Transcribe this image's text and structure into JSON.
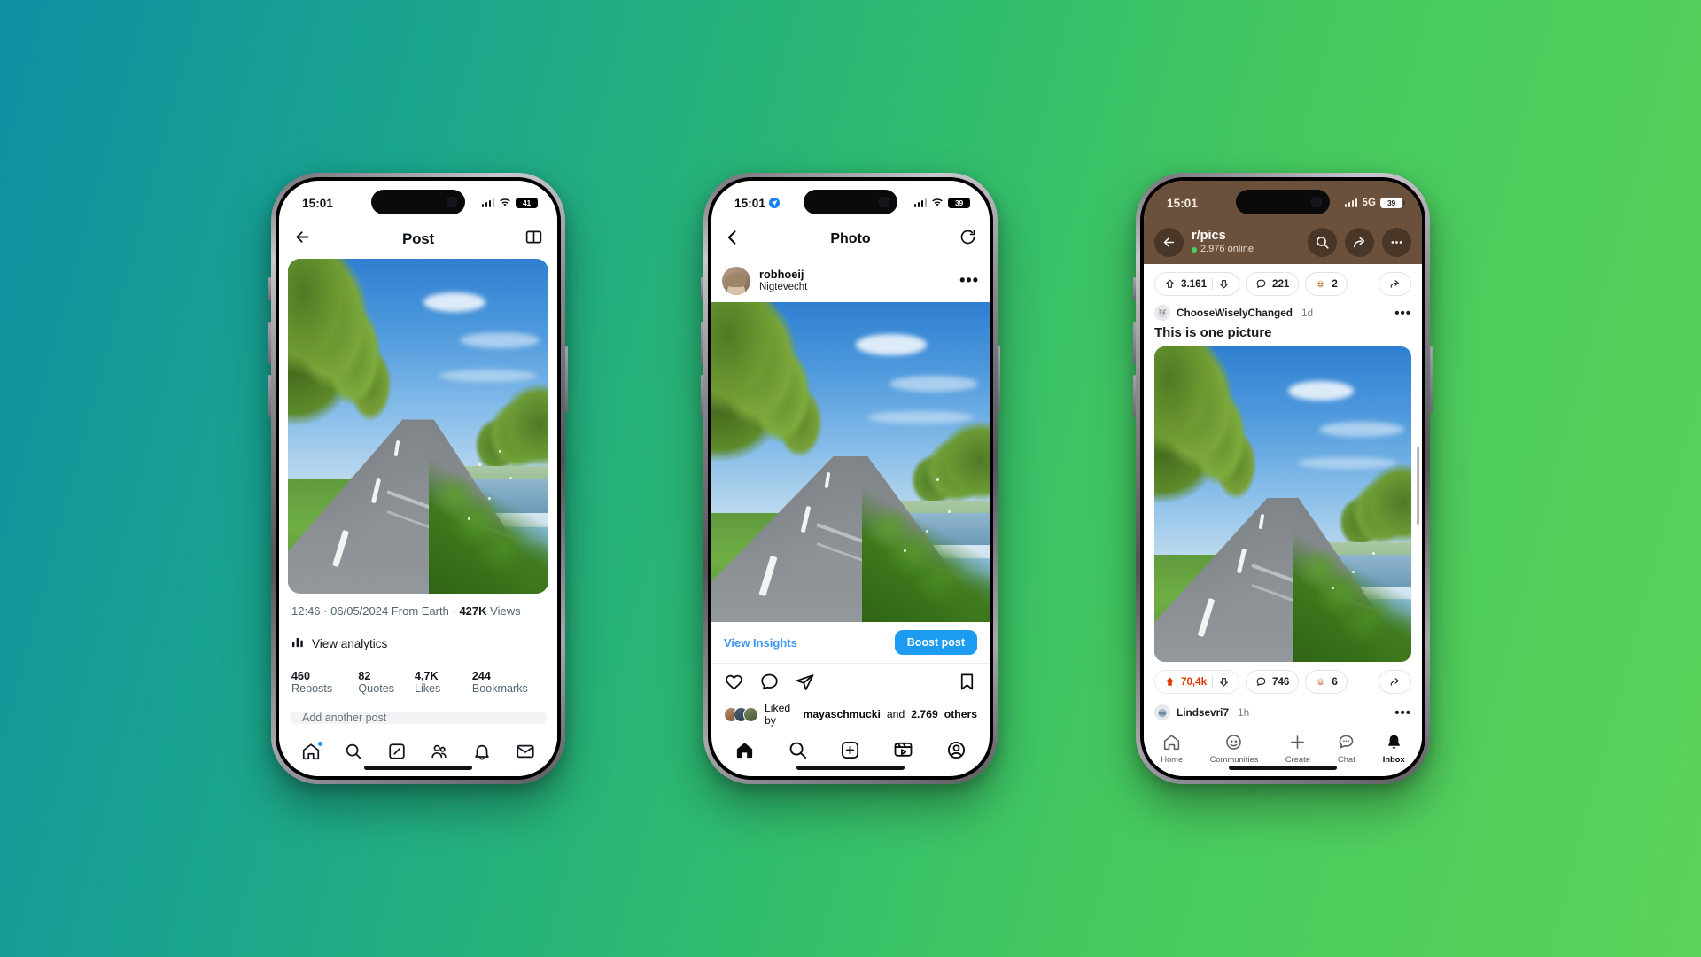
{
  "background": {
    "gradient_from": "#0e8fa3",
    "gradient_to": "#5cd35a"
  },
  "phones": {
    "twitter": {
      "app": "X",
      "status": {
        "time": "15:01",
        "battery": "41",
        "network_icon": "cellular-bars",
        "wifi": "wifi-icon"
      },
      "header": {
        "title": "Post",
        "back_icon": "arrow-left-icon",
        "reader_icon": "reader-mode-icon"
      },
      "meta": {
        "time": "12:46",
        "separator_1": "·",
        "date": "06/05/2024",
        "from": "From Earth",
        "separator_2": "·",
        "views_count": "427K",
        "views_label": "Views",
        "full": "12:46 · 06/05/2024 From Earth · 427K Views"
      },
      "analytics": {
        "label": "View analytics",
        "icon": "bar-chart-icon"
      },
      "counts": [
        {
          "value": "460",
          "label": "Reposts"
        },
        {
          "value": "82",
          "label": "Quotes"
        },
        {
          "value": "4,7K",
          "label": "Likes"
        },
        {
          "value": "244",
          "label": "Bookmarks"
        }
      ],
      "reply_placeholder": "Add another post",
      "tabs": [
        {
          "name": "home",
          "icon": "home-icon",
          "badge": true
        },
        {
          "name": "search",
          "icon": "search-icon",
          "badge": false
        },
        {
          "name": "grok",
          "icon": "grok-icon",
          "badge": false
        },
        {
          "name": "communities",
          "icon": "communities-icon",
          "badge": false
        },
        {
          "name": "notifications",
          "icon": "bell-icon",
          "badge": false
        },
        {
          "name": "messages",
          "icon": "envelope-icon",
          "badge": false
        }
      ]
    },
    "instagram": {
      "app": "Instagram",
      "status": {
        "time": "15:01",
        "location_icon": "location-arrow-icon",
        "battery": "39"
      },
      "header": {
        "title": "Photo",
        "back_icon": "chevron-left-icon",
        "refresh_icon": "rotate-ccw-icon"
      },
      "post": {
        "username": "robhoeij",
        "location": "Nigtevecht",
        "more_icon": "ellipsis-icon"
      },
      "insights": {
        "link": "View Insights",
        "boost_button": "Boost post",
        "boost_color": "#1b9cf0"
      },
      "actions": [
        {
          "name": "like",
          "icon": "heart-icon"
        },
        {
          "name": "comment",
          "icon": "comment-icon"
        },
        {
          "name": "share",
          "icon": "paper-plane-icon"
        },
        {
          "name": "save",
          "icon": "bookmark-icon"
        }
      ],
      "liked_by": {
        "prefix": "Liked by",
        "username": "mayaschmucki",
        "conjunction": "and",
        "others_count": "2.769",
        "others_label": "others"
      },
      "tabs": [
        {
          "name": "home",
          "icon": "home-filled-icon"
        },
        {
          "name": "search",
          "icon": "search-icon"
        },
        {
          "name": "create",
          "icon": "plus-square-icon"
        },
        {
          "name": "reels",
          "icon": "reels-icon"
        },
        {
          "name": "profile",
          "icon": "person-circle-icon"
        }
      ]
    },
    "reddit": {
      "app": "Reddit",
      "status": {
        "time": "15:01",
        "network": "5G",
        "battery": "39"
      },
      "header": {
        "back_icon": "arrow-left-icon",
        "subreddit": "r/pics",
        "online": "2.976 online",
        "search_icon": "search-icon",
        "share_icon": "share-icon",
        "more_icon": "ellipsis-icon"
      },
      "top_post_bar": {
        "upvotes": "3.161",
        "comments": "221",
        "awards": "2",
        "upvote_icon": "arrow-up-icon",
        "downvote_icon": "arrow-down-icon",
        "comment_icon": "comment-icon",
        "award_icon": "award-icon",
        "share_icon": "share-icon"
      },
      "post": {
        "author": "ChooseWiselyChanged",
        "age": "1d",
        "title": "This is one picture",
        "more_icon": "ellipsis-icon"
      },
      "bottom_post_bar": {
        "upvotes": "70,4k",
        "upvoted": true,
        "upvote_color": "#d93900",
        "comments": "746",
        "awards": "6"
      },
      "next_comment": {
        "author": "Lindsevri7",
        "age": "1h",
        "more_icon": "ellipsis-icon"
      },
      "tabs": [
        {
          "name": "home",
          "label": "Home",
          "icon": "home-icon",
          "active": false
        },
        {
          "name": "communities",
          "label": "Communities",
          "icon": "communities-icon",
          "active": false
        },
        {
          "name": "create",
          "label": "Create",
          "icon": "plus-icon",
          "active": false
        },
        {
          "name": "chat",
          "label": "Chat",
          "icon": "chat-icon",
          "active": false
        },
        {
          "name": "inbox",
          "label": "Inbox",
          "icon": "bell-filled-icon",
          "active": true
        }
      ]
    }
  }
}
